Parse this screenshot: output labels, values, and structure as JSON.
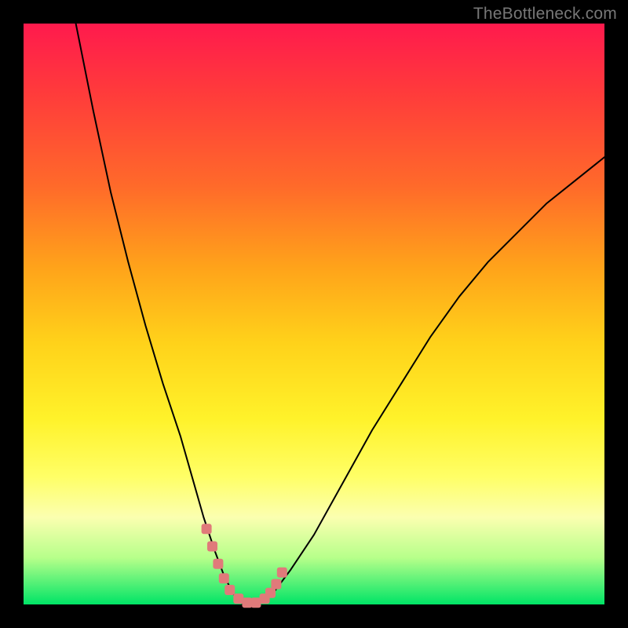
{
  "watermark": "TheBottleneck.com",
  "chart_data": {
    "type": "line",
    "title": "",
    "xlabel": "",
    "ylabel": "",
    "xlim": [
      0,
      100
    ],
    "ylim": [
      0,
      100
    ],
    "grid": false,
    "legend": false,
    "series": [
      {
        "name": "curve",
        "x": [
          9,
          12,
          15,
          18,
          21,
          24,
          27,
          29,
          31,
          33,
          34.5,
          36,
          37,
          38,
          40,
          43,
          46,
          50,
          55,
          60,
          65,
          70,
          75,
          80,
          85,
          90,
          95,
          100
        ],
        "y": [
          100,
          85,
          71,
          59,
          48,
          38,
          29,
          22,
          15,
          9,
          5,
          2,
          0.5,
          0,
          0,
          2,
          6,
          12,
          21,
          30,
          38,
          46,
          53,
          59,
          64,
          69,
          73,
          77
        ]
      }
    ],
    "markers": {
      "name": "highlight-points",
      "x": [
        31.5,
        32.5,
        33.5,
        34.5,
        35.5,
        37.0,
        38.5,
        40.0,
        41.5,
        42.5,
        43.5,
        44.5
      ],
      "y": [
        13.0,
        10.0,
        7.0,
        4.5,
        2.5,
        1.0,
        0.3,
        0.3,
        1.0,
        2.0,
        3.5,
        5.5
      ]
    }
  }
}
